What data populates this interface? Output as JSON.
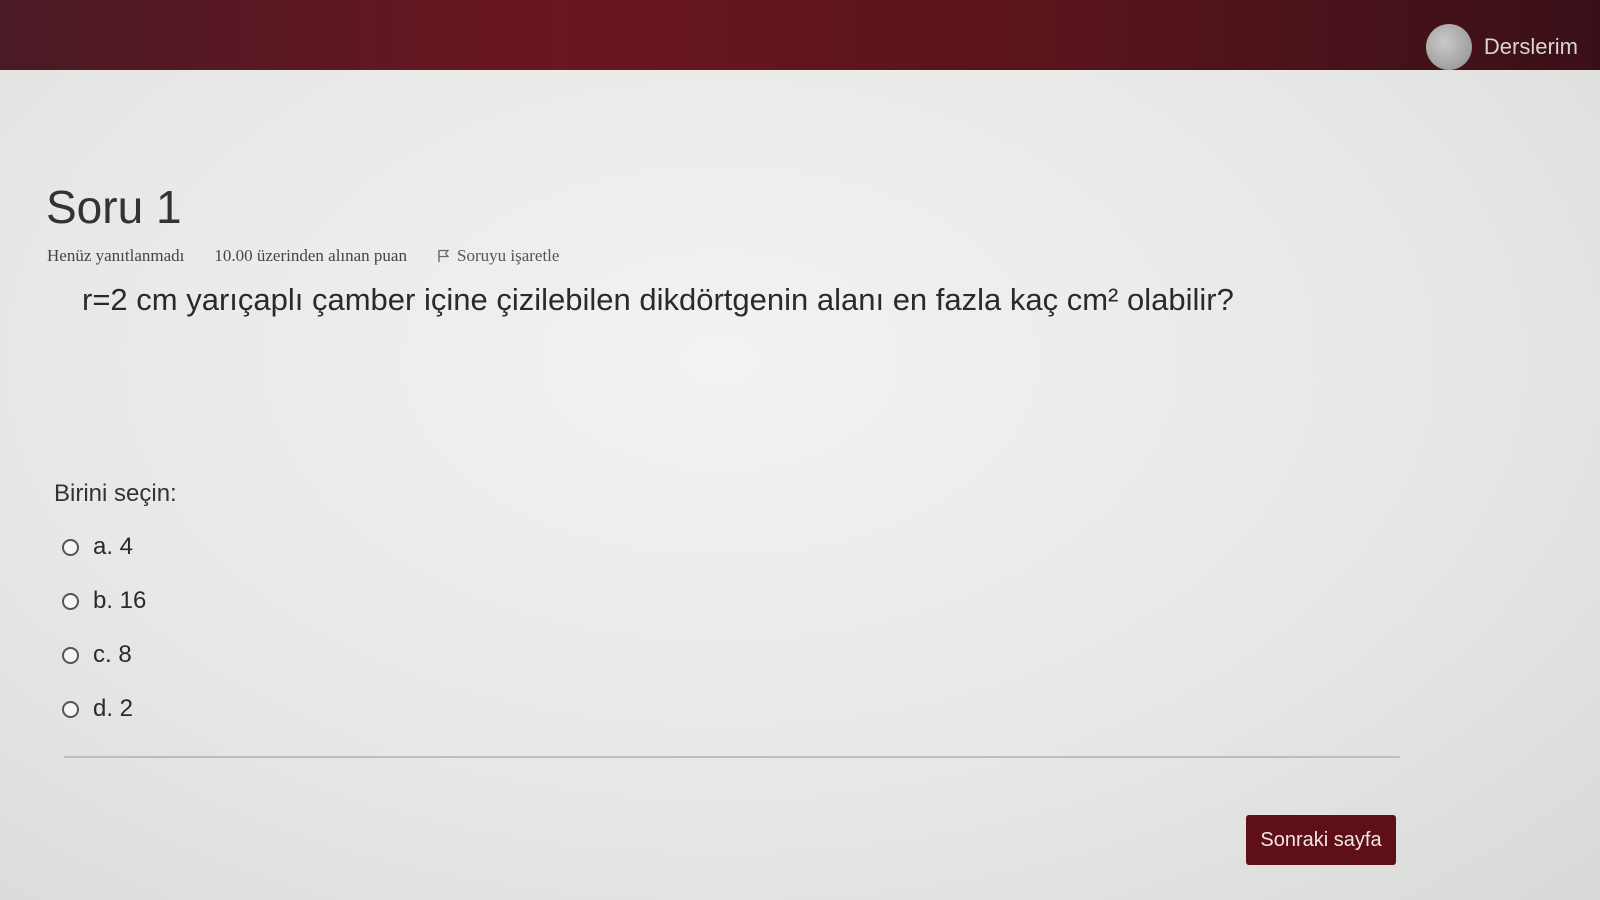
{
  "header": {
    "user_menu_label": "Derslerim"
  },
  "question": {
    "title": "Soru 1",
    "status": "Henüz yanıtlanmadı",
    "points": "10.00 üzerinden alınan puan",
    "flag_label": "Soruyu işaretle",
    "text": "r=2 cm yarıçaplı çamber içine çizilebilen dikdörtgenin alanı en fazla kaç cm² olabilir?",
    "prompt": "Birini seçin:",
    "answers": [
      {
        "label": "a. 4"
      },
      {
        "label": "b. 16"
      },
      {
        "label": "c. 8"
      },
      {
        "label": "d. 2"
      }
    ]
  },
  "footer": {
    "next_label": "Sonraki sayfa"
  }
}
